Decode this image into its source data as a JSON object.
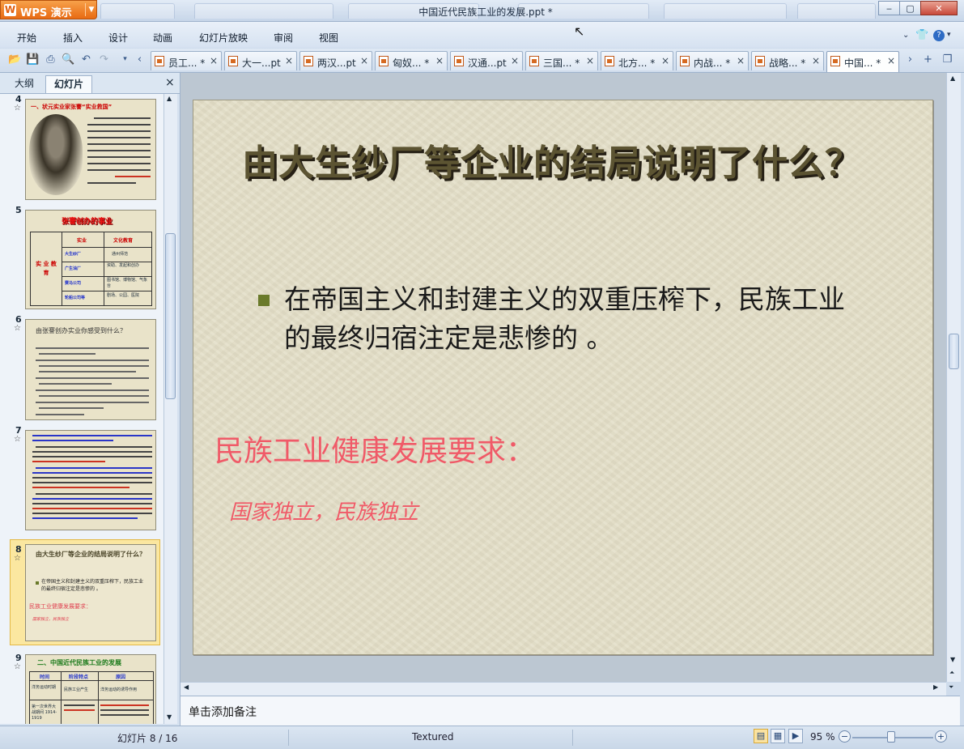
{
  "app": {
    "name": "WPS 演示",
    "logo": "W",
    "document_title": "中国近代民族工业的发展.ppt *"
  },
  "window_controls": {
    "minimize": "‒",
    "maximize": "▢",
    "close": "✕"
  },
  "menu": [
    "开始",
    "插入",
    "设计",
    "动画",
    "幻灯片放映",
    "审阅",
    "视图"
  ],
  "doc_tabs": [
    {
      "label": "员工... *",
      "active": false
    },
    {
      "label": "大一...pt",
      "active": false
    },
    {
      "label": "两汉...pt",
      "active": false
    },
    {
      "label": "匈奴... *",
      "active": false
    },
    {
      "label": "汉通...pt",
      "active": false
    },
    {
      "label": "三国... *",
      "active": false
    },
    {
      "label": "北方... *",
      "active": false
    },
    {
      "label": "内战... *",
      "active": false
    },
    {
      "label": "战略... *",
      "active": false
    },
    {
      "label": "中国... *",
      "active": true
    }
  ],
  "left_pane": {
    "tabs": [
      "大纲",
      "幻灯片"
    ],
    "active_tab": "幻灯片",
    "close": "×",
    "slides": [
      {
        "number": "4",
        "title": "一、状元实业家张謇“实业救国”"
      },
      {
        "number": "5",
        "title": "张謇创办的事业",
        "cells": [
          "实业",
          "文化教育",
          "大生纱厂",
          "通州师范",
          "广生油厂",
          "资助、发起和创办",
          "实 业 教 育",
          "赛马公司",
          "图书馆、博物馆、气象台",
          "轮船公司等",
          "剧场、公园、医院"
        ]
      },
      {
        "number": "6",
        "title": "由张謇创办实业你感受到什么？"
      },
      {
        "number": "7",
        "title": ""
      },
      {
        "number": "8",
        "title": "由大生纱厂等企业的结局说明了什么？",
        "bullet": "在帝国主义和封建主义的双重压榨下，民族工业的最终归宿注定是悲惨的 。",
        "heading": "民族工业健康发展要求：",
        "sub": "国家独立，民族独立",
        "selected": true
      },
      {
        "number": "9",
        "title": "二、中国近代民族工业的发展",
        "cells": [
          "时间",
          "阶段特点",
          "原因",
          "洋务运动时期",
          "民族工业产生",
          "洋务运动的诱导作用",
          "第一次世界大战期间 1914-1919"
        ]
      }
    ]
  },
  "slide": {
    "title": "由大生纱厂等企业的结局说明了什么？",
    "bullet": "在帝国主义和封建主义的双重压榨下，民族工业的最终归宿注定是悲惨的 。",
    "heading": "民族工业健康发展要求：",
    "sub": "国家独立，民族独立"
  },
  "notes": {
    "placeholder": "单击添加备注"
  },
  "status": {
    "slide_indicator": "幻灯片 8 / 16",
    "theme": "Textured",
    "zoom": "95 %",
    "zoom_level": 0.48
  }
}
